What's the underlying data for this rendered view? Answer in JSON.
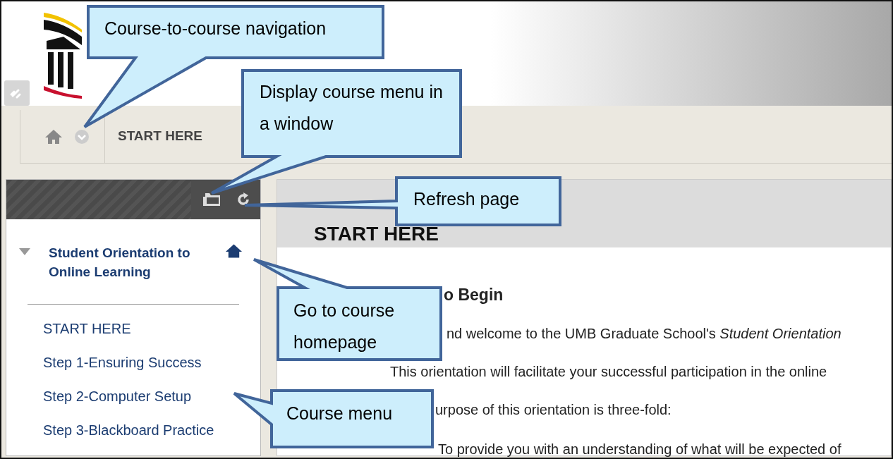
{
  "breadcrumb": {
    "current": "START HERE"
  },
  "course_menu": {
    "title": "Student Orientation to Online Learning",
    "expanded": true,
    "items": [
      {
        "label": "START HERE"
      },
      {
        "label": "Step 1-Ensuring Success"
      },
      {
        "label": "Step 2-Computer Setup"
      },
      {
        "label": "Step 3-Blackboard Practice"
      }
    ]
  },
  "content": {
    "title": "START HERE",
    "heading": "o Begin",
    "paragraphs": [
      "nd welcome to the UMB Graduate School's *Student Orientation*",
      "This orientation will facilitate your successful participation in the online",
      "urpose of this orientation is three-fold:"
    ],
    "bullets": [
      "To provide you with an understanding of what will be expected of"
    ]
  },
  "callouts": [
    {
      "text": "Course-to-course navigation"
    },
    {
      "text": "Display course menu in a window"
    },
    {
      "text": "Refresh page"
    },
    {
      "text": "Go to course homepage"
    },
    {
      "text": "Course menu"
    }
  ]
}
